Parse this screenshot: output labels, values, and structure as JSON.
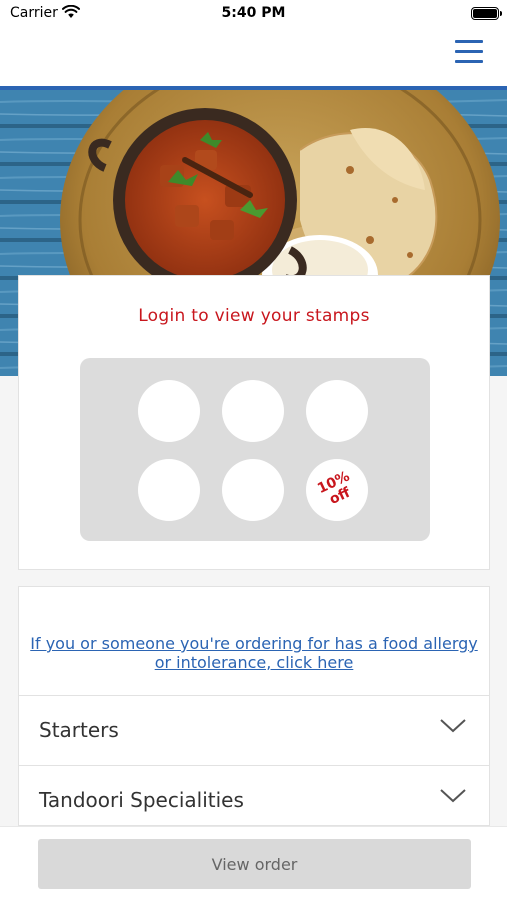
{
  "status_bar": {
    "carrier": "Carrier",
    "time": "5:40 PM"
  },
  "nav": {
    "menu_icon": "hamburger-menu-icon"
  },
  "colors": {
    "brand_blue": "#2b64b3",
    "accent_red": "#c8161d",
    "stamp_grid": "#dcdcdc"
  },
  "loyalty": {
    "title": "Login to view your stamps",
    "stamps_total": 6,
    "reward_label": "10%\noff"
  },
  "allergy": {
    "link_text": "If you or someone you're ordering for has a food allergy or intolerance, click here"
  },
  "categories": [
    {
      "label": "Starters"
    },
    {
      "label": "Tandoori Specialities"
    }
  ],
  "footer": {
    "view_order_label": "View order"
  }
}
